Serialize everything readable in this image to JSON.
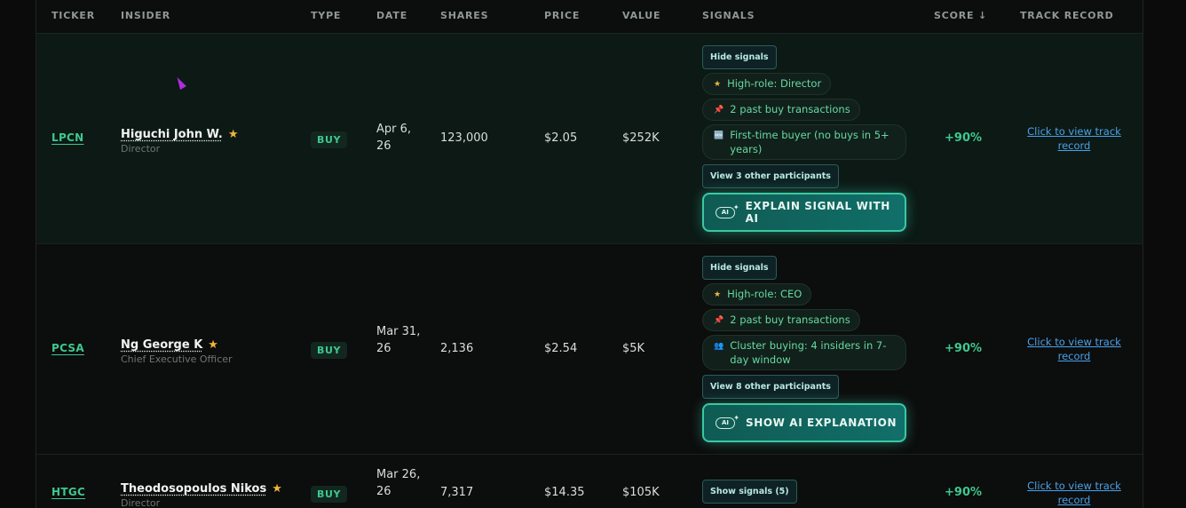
{
  "headers": {
    "ticker": "TICKER",
    "insider": "INSIDER",
    "type": "TYPE",
    "date": "DATE",
    "shares": "SHARES",
    "price": "PRICE",
    "value": "VALUE",
    "signals": "SIGNALS",
    "score": "SCORE ↓",
    "track_record": "TRACK RECORD"
  },
  "rows": [
    {
      "ticker": "LPCN",
      "insider_name": "Higuchi John W.",
      "insider_role": "Director",
      "type": "BUY",
      "date": "Apr 6, 26",
      "shares": "123,000",
      "price": "$2.05",
      "value": "$252K",
      "signals_toggle": "Hide signals",
      "signals": [
        {
          "icon": "star-icon",
          "glyph": "★",
          "text": "High-role: Director"
        },
        {
          "icon": "pin-icon",
          "glyph": "📌",
          "text": "2 past buy transactions"
        },
        {
          "icon": "new-icon",
          "glyph": "🆕",
          "text": "First-time buyer (no buys in 5+ years)"
        }
      ],
      "participants_button": "View 3 other participants",
      "ai_button": "EXPLAIN SIGNAL WITH AI",
      "score": "+90%",
      "track_record": "Click to view track record"
    },
    {
      "ticker": "PCSA",
      "insider_name": "Ng George K",
      "insider_role": "Chief Executive Officer",
      "type": "BUY",
      "date": "Mar 31, 26",
      "shares": "2,136",
      "price": "$2.54",
      "value": "$5K",
      "signals_toggle": "Hide signals",
      "signals": [
        {
          "icon": "star-icon",
          "glyph": "★",
          "text": "High-role: CEO"
        },
        {
          "icon": "pin-icon",
          "glyph": "📌",
          "text": "2 past buy transactions"
        },
        {
          "icon": "people-icon",
          "glyph": "👥",
          "text": "Cluster buying: 4 insiders in 7-day window"
        }
      ],
      "participants_button": "View 8 other participants",
      "ai_button": "SHOW AI EXPLANATION",
      "score": "+90%",
      "track_record": "Click to view track record"
    },
    {
      "ticker": "HTGC",
      "insider_name": "Theodosopoulos Nikos",
      "insider_role": "Director",
      "type": "BUY",
      "date": "Mar 26, 26",
      "shares": "7,317",
      "price": "$14.35",
      "value": "$105K",
      "signals_toggle": "Show signals (5)",
      "score": "+90%",
      "track_record": "Click to view track record"
    }
  ],
  "ai_tag": "AI",
  "colors": {
    "accent_green": "#3ec88e",
    "link_blue": "#4aa2e8",
    "star": "#f2b53b",
    "ai_button": "#116f69"
  }
}
